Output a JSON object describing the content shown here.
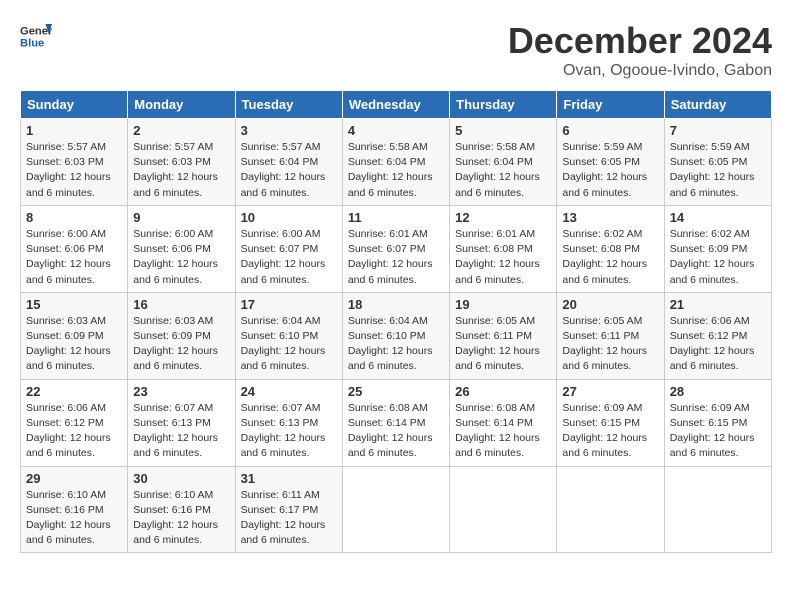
{
  "logo": {
    "line1": "General",
    "line2": "Blue"
  },
  "title": "December 2024",
  "location": "Ovan, Ogooue-Ivindo, Gabon",
  "weekdays": [
    "Sunday",
    "Monday",
    "Tuesday",
    "Wednesday",
    "Thursday",
    "Friday",
    "Saturday"
  ],
  "weeks": [
    [
      {
        "day": 1,
        "sunrise": "5:57 AM",
        "sunset": "6:03 PM",
        "daylight": "12 hours and 6 minutes."
      },
      {
        "day": 2,
        "sunrise": "5:57 AM",
        "sunset": "6:03 PM",
        "daylight": "12 hours and 6 minutes."
      },
      {
        "day": 3,
        "sunrise": "5:57 AM",
        "sunset": "6:04 PM",
        "daylight": "12 hours and 6 minutes."
      },
      {
        "day": 4,
        "sunrise": "5:58 AM",
        "sunset": "6:04 PM",
        "daylight": "12 hours and 6 minutes."
      },
      {
        "day": 5,
        "sunrise": "5:58 AM",
        "sunset": "6:04 PM",
        "daylight": "12 hours and 6 minutes."
      },
      {
        "day": 6,
        "sunrise": "5:59 AM",
        "sunset": "6:05 PM",
        "daylight": "12 hours and 6 minutes."
      },
      {
        "day": 7,
        "sunrise": "5:59 AM",
        "sunset": "6:05 PM",
        "daylight": "12 hours and 6 minutes."
      }
    ],
    [
      {
        "day": 8,
        "sunrise": "6:00 AM",
        "sunset": "6:06 PM",
        "daylight": "12 hours and 6 minutes."
      },
      {
        "day": 9,
        "sunrise": "6:00 AM",
        "sunset": "6:06 PM",
        "daylight": "12 hours and 6 minutes."
      },
      {
        "day": 10,
        "sunrise": "6:00 AM",
        "sunset": "6:07 PM",
        "daylight": "12 hours and 6 minutes."
      },
      {
        "day": 11,
        "sunrise": "6:01 AM",
        "sunset": "6:07 PM",
        "daylight": "12 hours and 6 minutes."
      },
      {
        "day": 12,
        "sunrise": "6:01 AM",
        "sunset": "6:08 PM",
        "daylight": "12 hours and 6 minutes."
      },
      {
        "day": 13,
        "sunrise": "6:02 AM",
        "sunset": "6:08 PM",
        "daylight": "12 hours and 6 minutes."
      },
      {
        "day": 14,
        "sunrise": "6:02 AM",
        "sunset": "6:09 PM",
        "daylight": "12 hours and 6 minutes."
      }
    ],
    [
      {
        "day": 15,
        "sunrise": "6:03 AM",
        "sunset": "6:09 PM",
        "daylight": "12 hours and 6 minutes."
      },
      {
        "day": 16,
        "sunrise": "6:03 AM",
        "sunset": "6:09 PM",
        "daylight": "12 hours and 6 minutes."
      },
      {
        "day": 17,
        "sunrise": "6:04 AM",
        "sunset": "6:10 PM",
        "daylight": "12 hours and 6 minutes."
      },
      {
        "day": 18,
        "sunrise": "6:04 AM",
        "sunset": "6:10 PM",
        "daylight": "12 hours and 6 minutes."
      },
      {
        "day": 19,
        "sunrise": "6:05 AM",
        "sunset": "6:11 PM",
        "daylight": "12 hours and 6 minutes."
      },
      {
        "day": 20,
        "sunrise": "6:05 AM",
        "sunset": "6:11 PM",
        "daylight": "12 hours and 6 minutes."
      },
      {
        "day": 21,
        "sunrise": "6:06 AM",
        "sunset": "6:12 PM",
        "daylight": "12 hours and 6 minutes."
      }
    ],
    [
      {
        "day": 22,
        "sunrise": "6:06 AM",
        "sunset": "6:12 PM",
        "daylight": "12 hours and 6 minutes."
      },
      {
        "day": 23,
        "sunrise": "6:07 AM",
        "sunset": "6:13 PM",
        "daylight": "12 hours and 6 minutes."
      },
      {
        "day": 24,
        "sunrise": "6:07 AM",
        "sunset": "6:13 PM",
        "daylight": "12 hours and 6 minutes."
      },
      {
        "day": 25,
        "sunrise": "6:08 AM",
        "sunset": "6:14 PM",
        "daylight": "12 hours and 6 minutes."
      },
      {
        "day": 26,
        "sunrise": "6:08 AM",
        "sunset": "6:14 PM",
        "daylight": "12 hours and 6 minutes."
      },
      {
        "day": 27,
        "sunrise": "6:09 AM",
        "sunset": "6:15 PM",
        "daylight": "12 hours and 6 minutes."
      },
      {
        "day": 28,
        "sunrise": "6:09 AM",
        "sunset": "6:15 PM",
        "daylight": "12 hours and 6 minutes."
      }
    ],
    [
      {
        "day": 29,
        "sunrise": "6:10 AM",
        "sunset": "6:16 PM",
        "daylight": "12 hours and 6 minutes."
      },
      {
        "day": 30,
        "sunrise": "6:10 AM",
        "sunset": "6:16 PM",
        "daylight": "12 hours and 6 minutes."
      },
      {
        "day": 31,
        "sunrise": "6:11 AM",
        "sunset": "6:17 PM",
        "daylight": "12 hours and 6 minutes."
      },
      null,
      null,
      null,
      null
    ]
  ]
}
